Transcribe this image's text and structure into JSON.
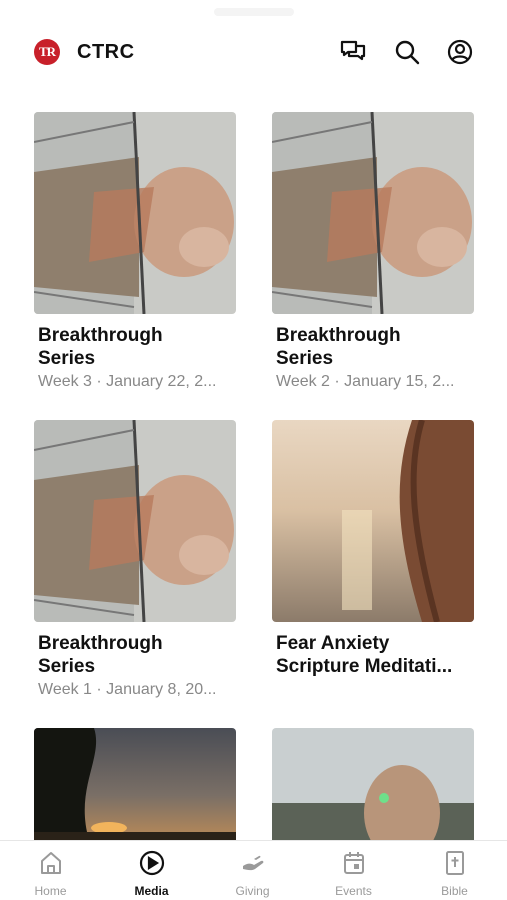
{
  "app": {
    "name": "CTRC",
    "logo_text": "TR"
  },
  "header": {
    "icons": [
      "messages-icon",
      "search-icon",
      "profile-icon"
    ]
  },
  "media": {
    "items": [
      {
        "title": "Breakthrough Series",
        "subtitle": "Week 3 · January 22, 2..."
      },
      {
        "title": "Breakthrough Series",
        "subtitle": "Week 2 · January 15, 2..."
      },
      {
        "title": "Breakthrough Series",
        "subtitle": "Week 1 · January 8, 20..."
      },
      {
        "title_line1": "Fear Anxiety",
        "title_line2": "Scripture Meditati...",
        "subtitle": ""
      },
      {
        "title": "",
        "subtitle": ""
      },
      {
        "title": "",
        "subtitle": ""
      }
    ],
    "titles_split": [
      [
        "Breakthrough",
        "Series"
      ],
      [
        "Breakthrough",
        "Series"
      ],
      [
        "Breakthrough",
        "Series"
      ],
      [
        "Fear Anxiety",
        "Scripture Meditati..."
      ]
    ]
  },
  "tabs": [
    {
      "label": "Home",
      "icon": "home-icon",
      "active": false
    },
    {
      "label": "Media",
      "icon": "play-icon",
      "active": true
    },
    {
      "label": "Giving",
      "icon": "giving-icon",
      "active": false
    },
    {
      "label": "Events",
      "icon": "calendar-icon",
      "active": false
    },
    {
      "label": "Bible",
      "icon": "bible-icon",
      "active": false
    }
  ],
  "colors": {
    "brand": "#c8202a",
    "active_tab": "#111111",
    "inactive_tab": "#9a9a9a"
  }
}
